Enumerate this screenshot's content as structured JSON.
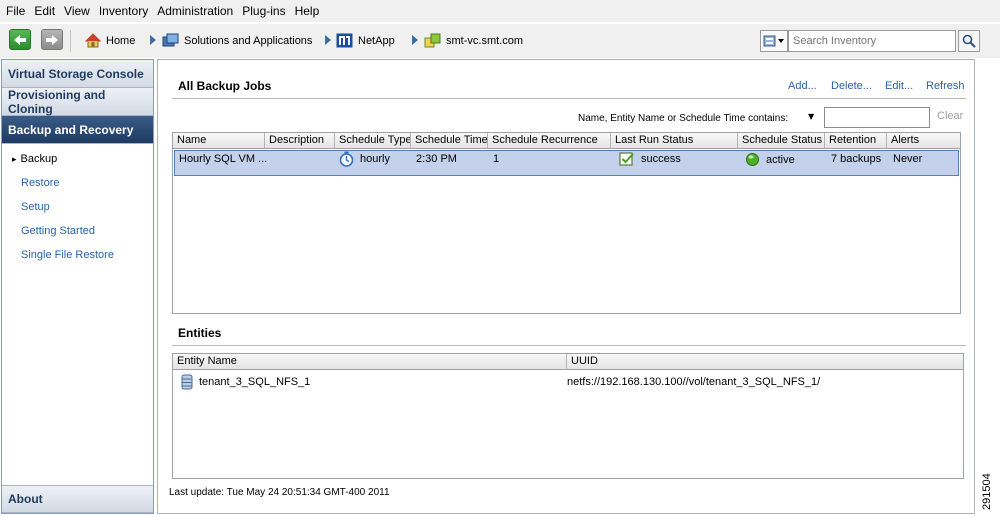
{
  "menu": [
    "File",
    "Edit",
    "View",
    "Inventory",
    "Administration",
    "Plug-ins",
    "Help"
  ],
  "nav": {
    "home": "Home",
    "breadcrumbs": [
      "Solutions and Applications",
      "NetApp",
      "smt-vc.smt.com"
    ],
    "search_placeholder": "Search Inventory"
  },
  "sidebar": {
    "sections": [
      "Virtual Storage Console",
      "Provisioning and Cloning",
      "Backup and Recovery",
      "About"
    ],
    "items": [
      "Backup",
      "Restore",
      "Setup",
      "Getting Started",
      "Single File Restore"
    ]
  },
  "backup_jobs": {
    "title": "All Backup Jobs",
    "actions": [
      "Add...",
      "Delete...",
      "Edit...",
      "Refresh"
    ],
    "filter_label": "Name, Entity Name or Schedule Time contains:",
    "clear": "Clear",
    "columns": [
      "Name",
      "Description",
      "Schedule Type",
      "Schedule Time",
      "Schedule Recurrence",
      "Last Run Status",
      "Schedule Status",
      "Retention",
      "Alerts"
    ],
    "rows": [
      {
        "name": "Hourly SQL VM ...",
        "description": "",
        "schedule_type": "hourly",
        "schedule_time": "2:30 PM",
        "recurrence": "1",
        "last_run": "success",
        "schedule_status": "active",
        "retention": "7 backups",
        "alerts": "Never"
      }
    ]
  },
  "entities": {
    "title": "Entities",
    "columns": [
      "Entity Name",
      "UUID"
    ],
    "rows": [
      {
        "name": "tenant_3_SQL_NFS_1",
        "uuid": "netfs://192.168.130.100//vol/tenant_3_SQL_NFS_1/"
      }
    ]
  },
  "status": "Last update: Tue May 24 20:51:34 GMT-400 2011",
  "figure_id": "291504"
}
